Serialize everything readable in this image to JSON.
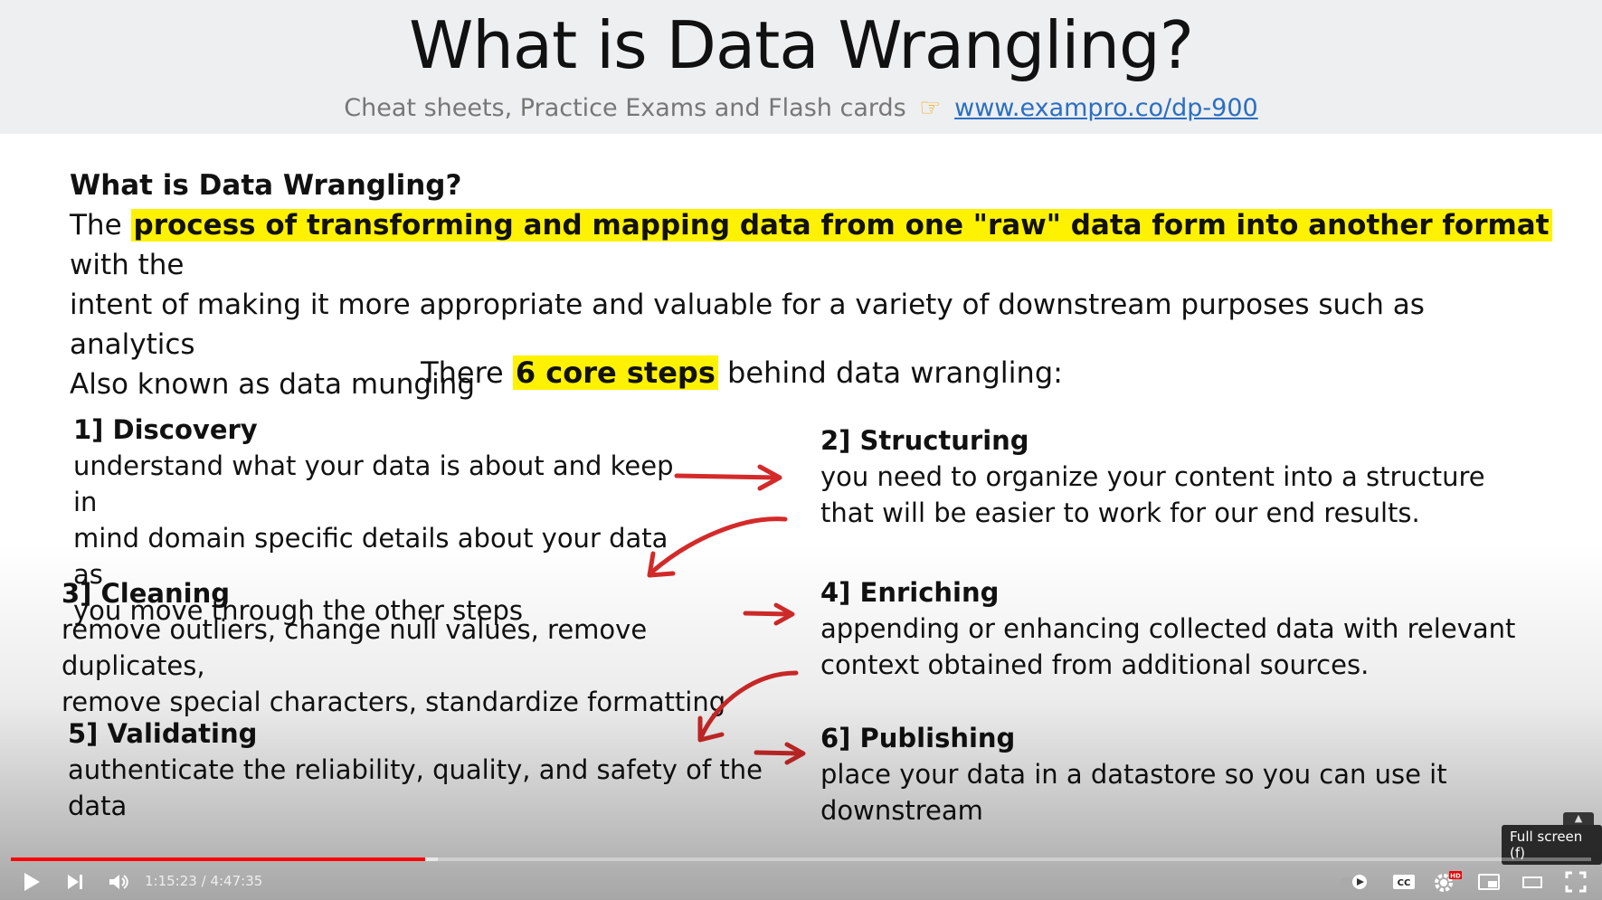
{
  "slide": {
    "title": "What is Data Wrangling?",
    "subtitle_text": "Cheat sheets, Practice Exams and Flash cards",
    "subtitle_link": "www.exampro.co/dp-900",
    "body": {
      "heading": "What is Data Wrangling?",
      "line1_prefix": "The",
      "line1_highlight": "process of transforming and mapping data from one \"raw\" data form into another format",
      "line1_suffix": "with the",
      "line2": "intent of making it more appropriate and valuable for a variety of downstream purposes such as analytics",
      "line3": "Also known as data munging"
    },
    "core": {
      "prefix": "There",
      "highlight": "6 core steps",
      "suffix": "behind data wrangling:"
    },
    "steps": [
      {
        "title": "1] Discovery",
        "lines": [
          "understand what your data is about and keep in",
          "mind domain specific details about your data as",
          "you move through the other steps"
        ]
      },
      {
        "title": "2] Structuring",
        "lines": [
          "you need to organize your content into a structure",
          "that will be easier to work for our end results."
        ]
      },
      {
        "title": "3] Cleaning",
        "lines": [
          "remove outliers, change null values, remove duplicates,",
          "remove special characters, standardize formatting"
        ]
      },
      {
        "title": "4] Enriching",
        "lines": [
          "appending or enhancing collected data with relevant",
          "context obtained from additional sources."
        ]
      },
      {
        "title": "5] Validating",
        "lines": [
          "authenticate the reliability, quality, and safety of the data"
        ]
      },
      {
        "title": "6] Publishing",
        "lines": [
          "place your data in a datastore so you can use it downstream"
        ]
      }
    ]
  },
  "player": {
    "time_current": "1:15:23",
    "time_separator": "/",
    "time_total": "4:47:35",
    "progress_fraction": 0.262,
    "buffer_fraction": 0.27,
    "tooltip": "Full screen (f)",
    "hd_badge": "HD",
    "icons": [
      "play-icon",
      "next-icon",
      "volume-icon",
      "autoplay-toggle-icon",
      "captions-icon",
      "settings-icon",
      "miniplayer-icon",
      "theater-icon",
      "fullscreen-icon"
    ],
    "accent_color": "#ff0000"
  },
  "colors": {
    "highlight": "#fff200",
    "arrow": "#d42a2a",
    "link": "#2b6fc2"
  }
}
